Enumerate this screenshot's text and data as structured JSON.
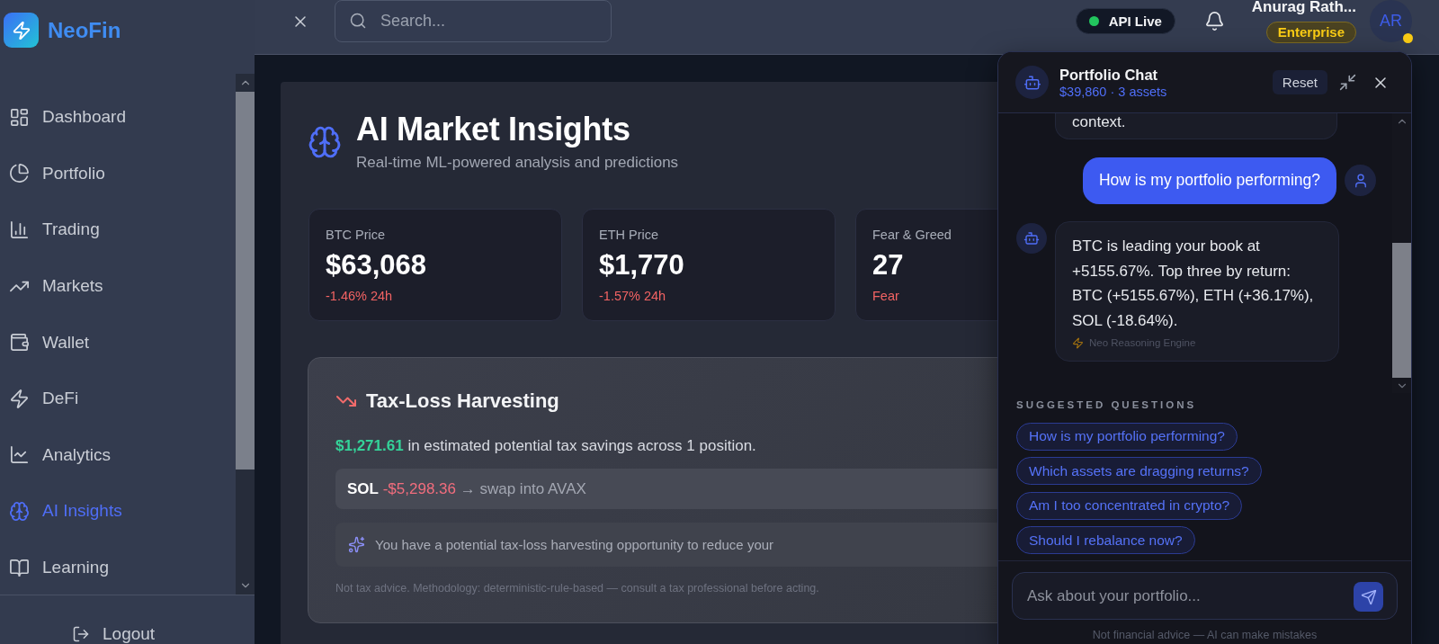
{
  "sidebar": {
    "brand": "NeoFin",
    "items": [
      {
        "label": "Dashboard",
        "selected": false
      },
      {
        "label": "Portfolio",
        "selected": false
      },
      {
        "label": "Trading",
        "selected": false
      },
      {
        "label": "Markets",
        "selected": false
      },
      {
        "label": "Wallet",
        "selected": false
      },
      {
        "label": "DeFi",
        "selected": false
      },
      {
        "label": "Analytics",
        "selected": false
      },
      {
        "label": "AI Insights",
        "selected": true
      },
      {
        "label": "Learning",
        "selected": false
      }
    ],
    "logout": "Logout"
  },
  "header": {
    "search": {
      "placeholder": "Search..."
    },
    "api_status": {
      "label": "API Live",
      "online": true
    },
    "user": {
      "name": "Anurag Rath...",
      "plan": "Enterprise",
      "initials": "AR",
      "away": true
    }
  },
  "page": {
    "title": "AI Market Insights",
    "subtitle": "Real-time ML-powered analysis and predictions",
    "stats": [
      {
        "label": "BTC Price",
        "value": "$63,068",
        "change": "-1.46% 24h",
        "negative": true
      },
      {
        "label": "ETH Price",
        "value": "$1,770",
        "change": "-1.57% 24h",
        "negative": true
      },
      {
        "label": "Fear & Greed",
        "value": "27",
        "change": "Fear",
        "negative": true
      }
    ],
    "tax_loss": {
      "title": "Tax-Loss Harvesting",
      "savings": "$1,271.61",
      "summary": "in estimated potential tax savings across 1 position.",
      "positions": [
        {
          "asset": "SOL",
          "loss": "-$5,298.36",
          "action": "→ swap into AVAX"
        }
      ],
      "insight": "You have a potential tax-loss harvesting opportunity to reduce your",
      "disclaimer": "Not tax advice. Methodology: deterministic-rule-based — consult a tax professional before acting."
    }
  },
  "chat": {
    "title": "Portfolio Chat",
    "subtitle": "$39,860 · 3 assets",
    "reset": "Reset",
    "messages": [
      {
        "kind": "assistant",
        "text": "context.",
        "cut_off": true
      },
      {
        "kind": "user",
        "text": "How is my portfolio performing?"
      },
      {
        "kind": "assistant",
        "text": "BTC is leading your book at +5155.67%. Top three by return: BTC (+5155.67%), ETH (+36.17%), SOL (-18.64%).",
        "cut_off": false,
        "source": "Neo Reasoning Engine"
      }
    ],
    "suggestions_title": "SUGGESTED QUESTIONS",
    "suggestions": [
      "How is my portfolio performing?",
      "Which assets are dragging returns?",
      "Am I too concentrated in crypto?",
      "Should I rebalance now?"
    ],
    "input": {
      "placeholder": "Ask about your portfolio..."
    },
    "footer": "Not financial advice — AI can make mistakes"
  }
}
